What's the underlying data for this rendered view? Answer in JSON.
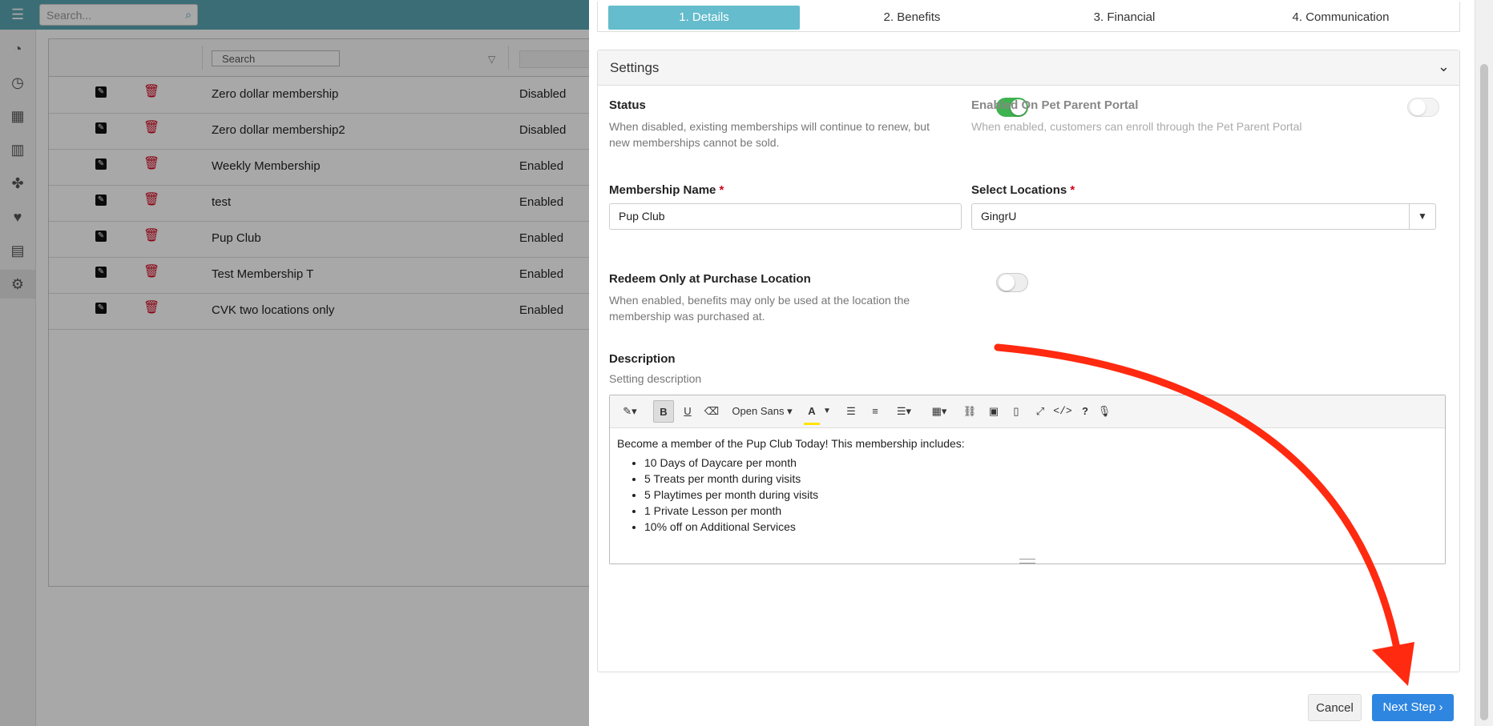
{
  "app": {
    "global_search_placeholder": "Search..."
  },
  "grid": {
    "column_search_placeholder": "Search",
    "rows": [
      {
        "name": "Zero dollar membership",
        "status": "Disabled"
      },
      {
        "name": "Zero dollar membership2",
        "status": "Disabled"
      },
      {
        "name": "Weekly Membership",
        "status": "Enabled"
      },
      {
        "name": "test",
        "status": "Enabled"
      },
      {
        "name": "Pup Club",
        "status": "Enabled"
      },
      {
        "name": "Test Membership T",
        "status": "Enabled"
      },
      {
        "name": "CVK two locations only",
        "status": "Enabled"
      }
    ]
  },
  "wizard": {
    "steps": [
      "1. Details",
      "2. Benefits",
      "3. Financial",
      "4. Communication"
    ],
    "active_step": 0
  },
  "settings": {
    "title": "Settings",
    "status_label": "Status",
    "status_help": "When disabled, existing memberships will continue to renew, but new memberships cannot be sold.",
    "status_on": true,
    "portal_label": "Enabled On Pet Parent Portal",
    "portal_help": "When enabled, customers can enroll through the Pet Parent Portal",
    "portal_on": false,
    "name_label": "Membership Name",
    "name_value": "Pup Club",
    "locations_label": "Select Locations",
    "locations_value": "GingrU",
    "required_mark": "*",
    "redeem_label": "Redeem Only at Purchase Location",
    "redeem_help": "When enabled, benefits may only be used at the location the membership was purchased at.",
    "redeem_on": false,
    "description_label": "Description",
    "description_help": "Setting description",
    "editor_font": "Open Sans",
    "description_intro": "Become a member of the Pup Club Today! This membership includes:",
    "description_items": [
      "10 Days of Daycare per month",
      "5 Treats per month during visits",
      "5 Playtimes per month during visits",
      "1 Private Lesson per month",
      "10% off on Additional Services"
    ]
  },
  "footer": {
    "cancel_label": "Cancel",
    "next_label": "Next Step"
  },
  "colors": {
    "active_step": "#64bccc",
    "toggle_on": "#3fb34f",
    "primary": "#2e86e0",
    "annotation_arrow": "#ff2a10"
  },
  "icons": [
    "hamburger-icon",
    "search-icon",
    "dashboard-icon",
    "clock-icon",
    "calendar-icon",
    "barcode-icon",
    "paw-icon",
    "heart-icon",
    "book-icon",
    "gears-icon",
    "edit-icon",
    "trash-icon",
    "filter-icon",
    "chevron-down-icon",
    "caret-down-icon"
  ]
}
